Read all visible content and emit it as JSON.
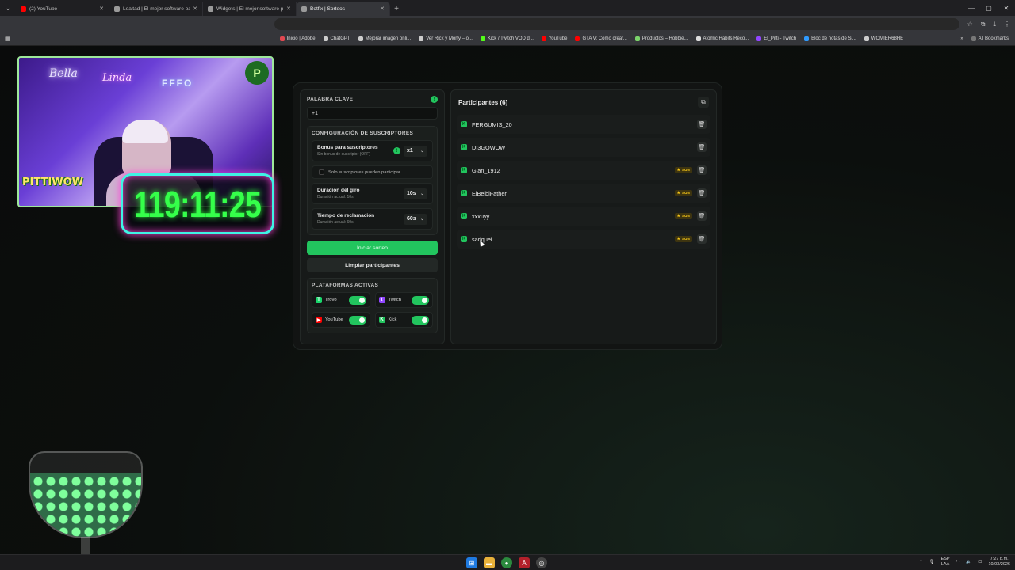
{
  "browser": {
    "tabs": [
      {
        "title": "(2) YouTube",
        "color": "#ff0000",
        "active": false
      },
      {
        "title": "Leaitad | El mejor software pa...",
        "color": "#9a9a9a",
        "active": false
      },
      {
        "title": "Widgets | El mejor software pa...",
        "color": "#9a9a9a",
        "active": false
      },
      {
        "title": "Botfix | Sorteos",
        "color": "#9a9a9a",
        "active": true
      }
    ],
    "bookmarks": [
      {
        "label": "Inicio | Adobe",
        "color": "#e34850"
      },
      {
        "label": "ChatGPT",
        "color": "#cccccc"
      },
      {
        "label": "Mejorar imagen onli...",
        "color": "#cccccc"
      },
      {
        "label": "Ver Rick y Morty – o...",
        "color": "#cccccc"
      },
      {
        "label": "Kick / Twitch VOD d...",
        "color": "#53fc18"
      },
      {
        "label": "YouTube",
        "color": "#ff0000"
      },
      {
        "label": "GTA V: Cómo crear...",
        "color": "#ff0000"
      },
      {
        "label": "Productos – Hobbie...",
        "color": "#7bd36b"
      },
      {
        "label": "Atomic Habits Reco...",
        "color": "#dddddd"
      },
      {
        "label": "El_Pitti - Twitch",
        "color": "#9146ff"
      },
      {
        "label": "Bloc de notas de Si...",
        "color": "#2f9bff"
      },
      {
        "label": "WOMIER68HE",
        "color": "#cccccc"
      }
    ],
    "all_bookmarks": "All Bookmarks"
  },
  "overlay": {
    "webcam_badge": "PITTIWOW",
    "neon_left": "Bella",
    "neon_mid": "Linda",
    "neon_right": "FFFO",
    "logo_letter": "P",
    "timer": "119:11:25"
  },
  "settings": {
    "keyword_label": "PALABRA CLAVE",
    "keyword_value": "+1",
    "subs_section_title": "CONFIGURACIÓN DE SUSCRIPTORES",
    "bonus": {
      "title": "Bonus para suscriptores",
      "subtitle": "Sin bonus de suscriptor (OFF)",
      "value": "x1"
    },
    "only_subs_label": "Solo suscriptores pueden participar",
    "spin": {
      "title": "Duración del giro",
      "subtitle": "Duración actual: 10s",
      "value": "10s"
    },
    "claim": {
      "title": "Tiempo de reclamación",
      "subtitle": "Duración actual: 60s",
      "value": "60s"
    },
    "start_button": "Iniciar sorteo",
    "clear_button": "Limpiar participantes",
    "platforms_title": "PLATAFORMAS ACTIVAS",
    "platforms": [
      {
        "name": "Trovo",
        "color": "#19d66b",
        "glyph": "T",
        "enabled": true
      },
      {
        "name": "Twitch",
        "color": "#9146ff",
        "glyph": "t",
        "enabled": true
      },
      {
        "name": "YouTube",
        "color": "#ff0000",
        "glyph": "▶",
        "enabled": true
      },
      {
        "name": "Kick",
        "color": "#22c55e",
        "glyph": "K",
        "enabled": true
      }
    ]
  },
  "participants": {
    "title": "Participantes (6)",
    "sub_label": "SUB",
    "items": [
      {
        "name": "FERGUMIS_20",
        "sub": false
      },
      {
        "name": "DI3GOWOW",
        "sub": false
      },
      {
        "name": "Gian_1912",
        "sub": true
      },
      {
        "name": "ElBeibiFather",
        "sub": true
      },
      {
        "name": "xxxuyy",
        "sub": true
      },
      {
        "name": "sarlquel",
        "sub": true
      }
    ]
  },
  "taskbar": {
    "lang_top": "ESP",
    "lang_bottom": "LAA",
    "time": "7:27 p.m.",
    "date": "10/03/2026"
  }
}
